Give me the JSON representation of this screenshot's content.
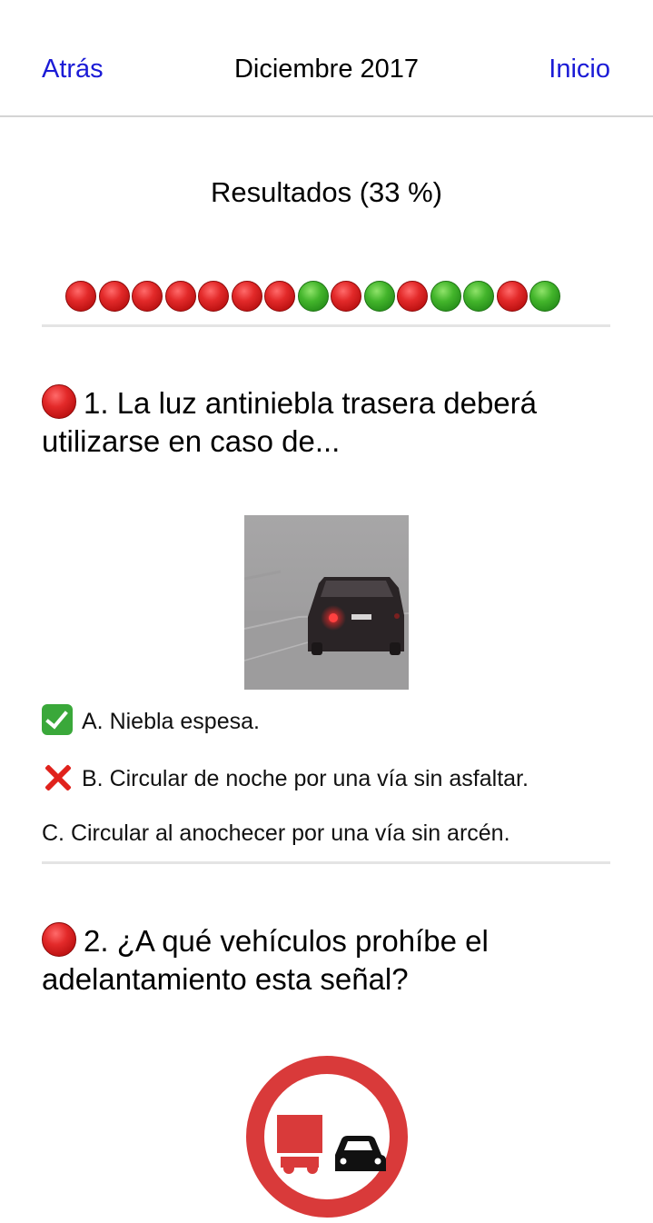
{
  "nav": {
    "back_label": "Atrás",
    "title": "Diciembre 2017",
    "home_label": "Inicio",
    "link_color": "#1b1bd6"
  },
  "results": {
    "title": "Resultados (33 %)",
    "percent": 33,
    "dots": [
      "red",
      "red",
      "red",
      "red",
      "red",
      "red",
      "red",
      "green",
      "red",
      "green",
      "red",
      "green",
      "green",
      "red",
      "green"
    ]
  },
  "questions": [
    {
      "status": "incorrect",
      "text": "1. La luz antiniebla trasera deberá utilizarse en caso de...",
      "image": "fog-car-rear-lights",
      "answers": [
        {
          "status": "correct",
          "icon": "check-icon",
          "text": "A. Niebla espesa."
        },
        {
          "status": "selected-wrong",
          "icon": "cross-icon",
          "text": "B. Circular de noche por una vía sin asfaltar."
        },
        {
          "status": "none",
          "icon": "",
          "text": "C. Circular al anochecer por una vía sin arcén."
        }
      ]
    },
    {
      "status": "incorrect",
      "text": "2. ¿A qué vehículos prohíbe el adelantamiento esta señal?",
      "image": "no-overtaking-trucks-sign"
    }
  ],
  "colors": {
    "red_dot": "#e32a2a",
    "green_dot": "#43b52b",
    "sign_red": "#d93a3a"
  }
}
